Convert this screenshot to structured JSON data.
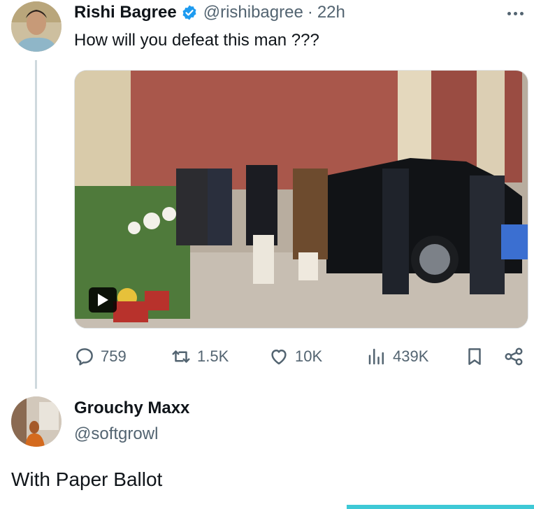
{
  "tweet": {
    "author_name": "Rishi Bagree",
    "author_handle": "@rishibagree",
    "separator": "·",
    "time": "22h",
    "text": "How will you defeat this man ???",
    "verified_color": "#1d9bf0",
    "metrics": {
      "replies": "759",
      "reposts": "1.5K",
      "likes": "10K",
      "views": "439K"
    },
    "icons": [
      "reply-icon",
      "repost-icon",
      "like-icon",
      "views-icon",
      "bookmark-icon",
      "share-icon"
    ]
  },
  "reply": {
    "author_name": "Grouchy Maxx",
    "author_handle": "@softgrowl",
    "text": "With Paper Ballot"
  },
  "colors": {
    "text_primary": "#0f1419",
    "text_secondary": "#536471",
    "thread_line": "#cfd9de",
    "accent_bar": "#3ec9d6"
  }
}
